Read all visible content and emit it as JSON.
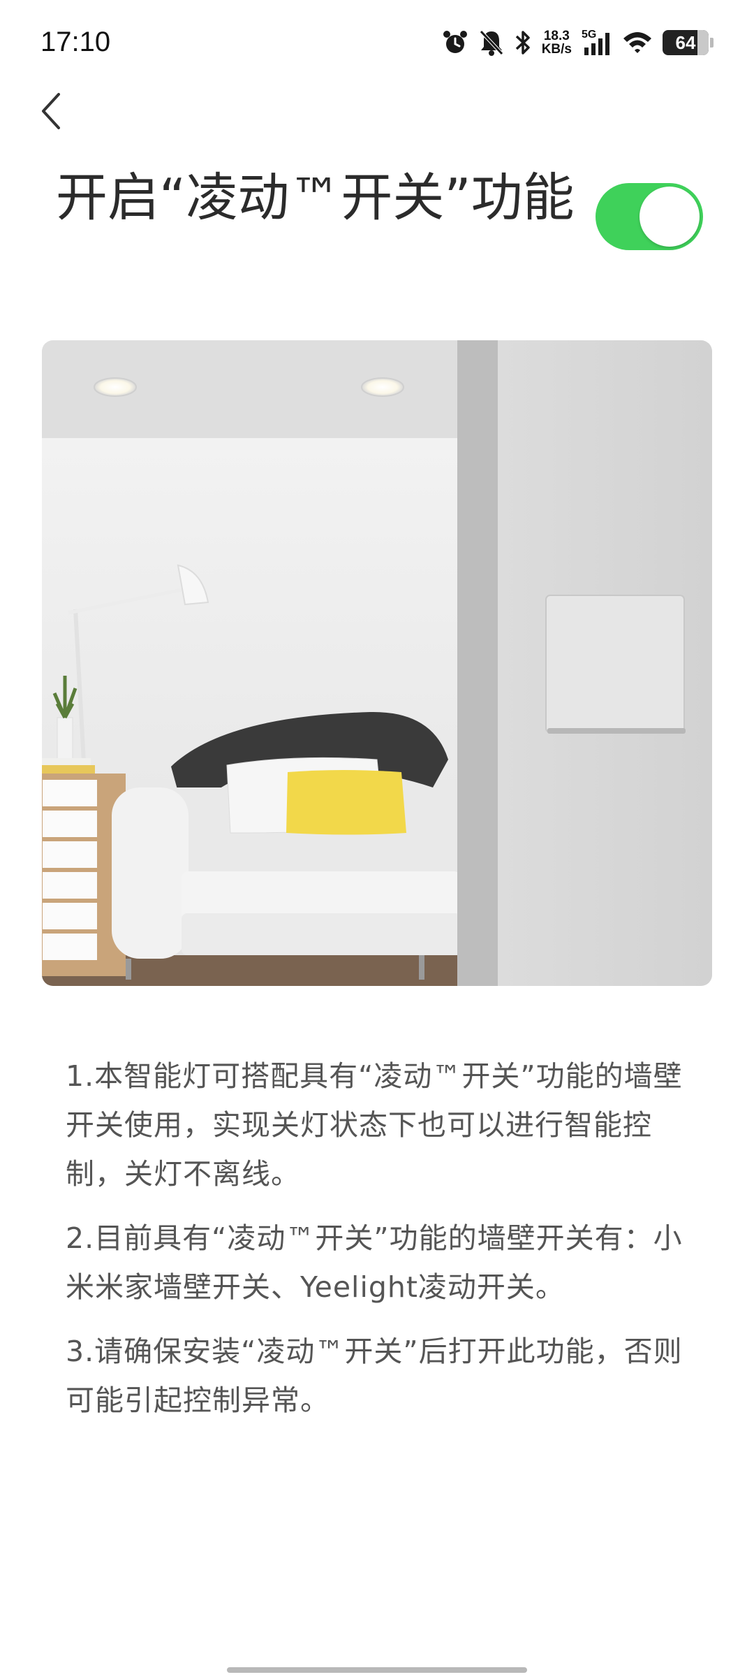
{
  "status_bar": {
    "time": "17:10",
    "net_speed_value": "18.3",
    "net_speed_unit": "KB/s",
    "network_type": "5G",
    "battery": "64",
    "icons": [
      "alarm-icon",
      "bell-muted-icon",
      "bluetooth-icon",
      "signal-icon",
      "wifi-icon",
      "battery-icon"
    ]
  },
  "header": {
    "back_icon": "chevron-left-icon",
    "title": "开启“凌动™开关”功能",
    "toggle_on": true,
    "toggle_color": "#3fd15a"
  },
  "description": [
    "1.本智能灯可搭配具有“凌动™开关”功能的墙壁开关使用，实现关灯状态下也可以进行智能控制，关灯不离线。",
    "2.目前具有“凌动™开关”功能的墙壁开关有：小米米家墙壁开关、Yeelight凌动开关。",
    "3.请确保安装“凌动™开关”后打开此功能，否则可能引起控制异常。"
  ]
}
